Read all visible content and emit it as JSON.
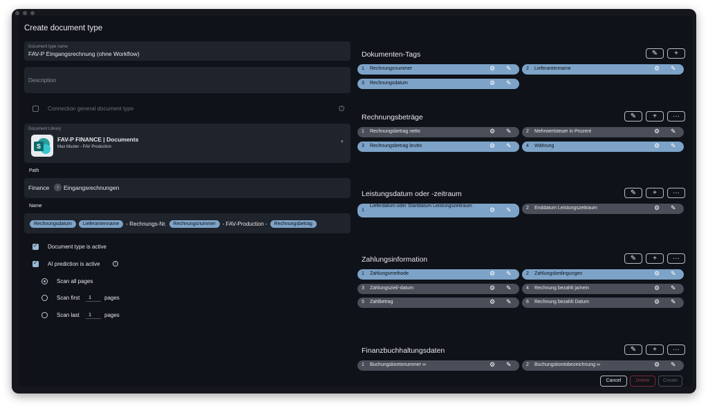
{
  "dialog": {
    "title": "Create document type"
  },
  "left": {
    "name_label": "Document type name",
    "name_value": "FAV-P Eingangsrechnung (ohne Workflow)",
    "description_placeholder": "Description",
    "connection_label": "Connection general document type",
    "library_label": "Document Library",
    "library_name": "FAV-P FINANCE | Documents",
    "library_sub": "Max Muster - FAV Production",
    "path_heading": "Path",
    "path_root": "Finance",
    "path_leaf": "Eingangsrechnungen",
    "name_heading": "Name",
    "name_parts": [
      {
        "type": "chip",
        "text": "Rechnungsdatum"
      },
      {
        "type": "chip",
        "text": "Lieferantenname"
      },
      {
        "type": "text",
        "text": "- Rechnungs-Nr."
      },
      {
        "type": "chip",
        "text": "Rechnungsnummer"
      },
      {
        "type": "text",
        "text": "- FAV-Production -"
      },
      {
        "type": "chip",
        "text": "Rechnungsbetrag"
      }
    ],
    "active_label": "Document type is active",
    "ai_label": "AI prediction is active",
    "scan_all": "Scan all pages",
    "scan_first": "Scan first",
    "scan_first_n": "1",
    "scan_last": "Scan last",
    "scan_last_n": "1",
    "pages_word": "pages"
  },
  "sections": [
    {
      "title": "Dokumenten-Tags",
      "buttons": [
        "pencil",
        "plus"
      ],
      "tags": [
        {
          "num": "1",
          "label": "Rechnungsnummer",
          "color": "blue"
        },
        {
          "num": "2",
          "label": "Lieferantenname",
          "color": "blue"
        },
        {
          "num": "3",
          "label": "Rechnungsdatum",
          "color": "blue"
        }
      ]
    },
    {
      "title": "Rechnungsbeträge",
      "buttons": [
        "pencil",
        "plus",
        "more"
      ],
      "tags": [
        {
          "num": "1",
          "label": "Rechnungsbetrag netto",
          "color": "gray"
        },
        {
          "num": "2",
          "label": "Mehrwertsteuer in Prozent",
          "color": "gray"
        },
        {
          "num": "3",
          "label": "Rechnungsbetrag brutto",
          "color": "blue"
        },
        {
          "num": "4",
          "label": "Währung",
          "color": "blue"
        }
      ]
    },
    {
      "title": "Leistungsdatum oder -zeitraum",
      "buttons": [
        "pencil",
        "plus",
        "more"
      ],
      "tags": [
        {
          "num": "1",
          "label": "Lieferdatum oder Startdatum Leistungszeitraum",
          "color": "blue"
        },
        {
          "num": "2",
          "label": "Enddatum Leistungszeitraum",
          "color": "gray"
        }
      ]
    },
    {
      "title": "Zahlungsinformation",
      "buttons": [
        "pencil",
        "plus",
        "more"
      ],
      "tags": [
        {
          "num": "1",
          "label": "Zahlungsmethode",
          "color": "blue"
        },
        {
          "num": "2",
          "label": "Zahlungsbedingungen",
          "color": "blue"
        },
        {
          "num": "3",
          "label": "Zahlungsziel/-datum",
          "color": "gray"
        },
        {
          "num": "4",
          "label": "Rechnung bezahlt ja/nein",
          "color": "gray"
        },
        {
          "num": "5",
          "label": "Zahlbetrag",
          "color": "gray"
        },
        {
          "num": "6",
          "label": "Rechnung bezahlt Datum",
          "color": "gray"
        }
      ]
    },
    {
      "title": "Finanzbuchhaltungsdaten",
      "buttons": [
        "pencil",
        "plus",
        "more"
      ],
      "tags": [
        {
          "num": "1",
          "label": "Buchungskontonummer ∞",
          "color": "gray"
        },
        {
          "num": "2",
          "label": "Buchungskontobezeichnung ∞",
          "color": "gray"
        }
      ]
    }
  ],
  "footer": {
    "cancel": "Cancel",
    "delete": "Delete",
    "create": "Create"
  },
  "icons": {
    "edit": "pencil-icon",
    "settings": "gear-icon",
    "add": "plus-icon",
    "more": "more-icon"
  }
}
